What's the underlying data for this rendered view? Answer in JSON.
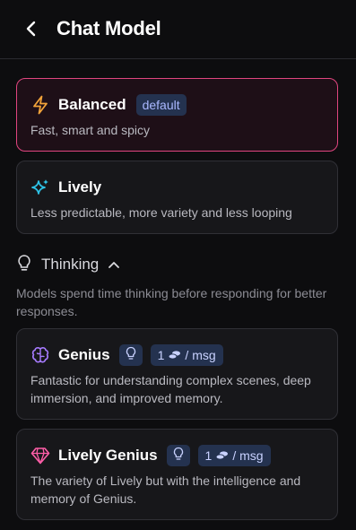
{
  "header": {
    "title": "Chat Model"
  },
  "models": [
    {
      "name": "Balanced",
      "badge": "default",
      "description": "Fast, smart and spicy",
      "selected": true,
      "icon": "lightning-icon"
    },
    {
      "name": "Lively",
      "description": "Less predictable, more variety and less looping",
      "icon": "sparkles-icon"
    }
  ],
  "thinking": {
    "label": "Thinking",
    "description": "Models spend time thinking before responding for better responses.",
    "models": [
      {
        "name": "Genius",
        "cost": "1",
        "cost_unit": "/ msg",
        "description": "Fantastic for understanding complex scenes, deep immersion, and improved memory.",
        "icon": "brain-icon"
      },
      {
        "name": "Lively Genius",
        "cost": "1",
        "cost_unit": "/ msg",
        "description": "The variety of Lively but with the intelligence and memory of Genius.",
        "icon": "diamond-icon"
      }
    ]
  },
  "colors": {
    "accent_pink": "#e0457f",
    "badge_bg": "#24324f",
    "bolt": "#f2a33a",
    "sparkle": "#2ec4e8",
    "brain": "#a77bff",
    "diamond": "#ff5ea8"
  }
}
